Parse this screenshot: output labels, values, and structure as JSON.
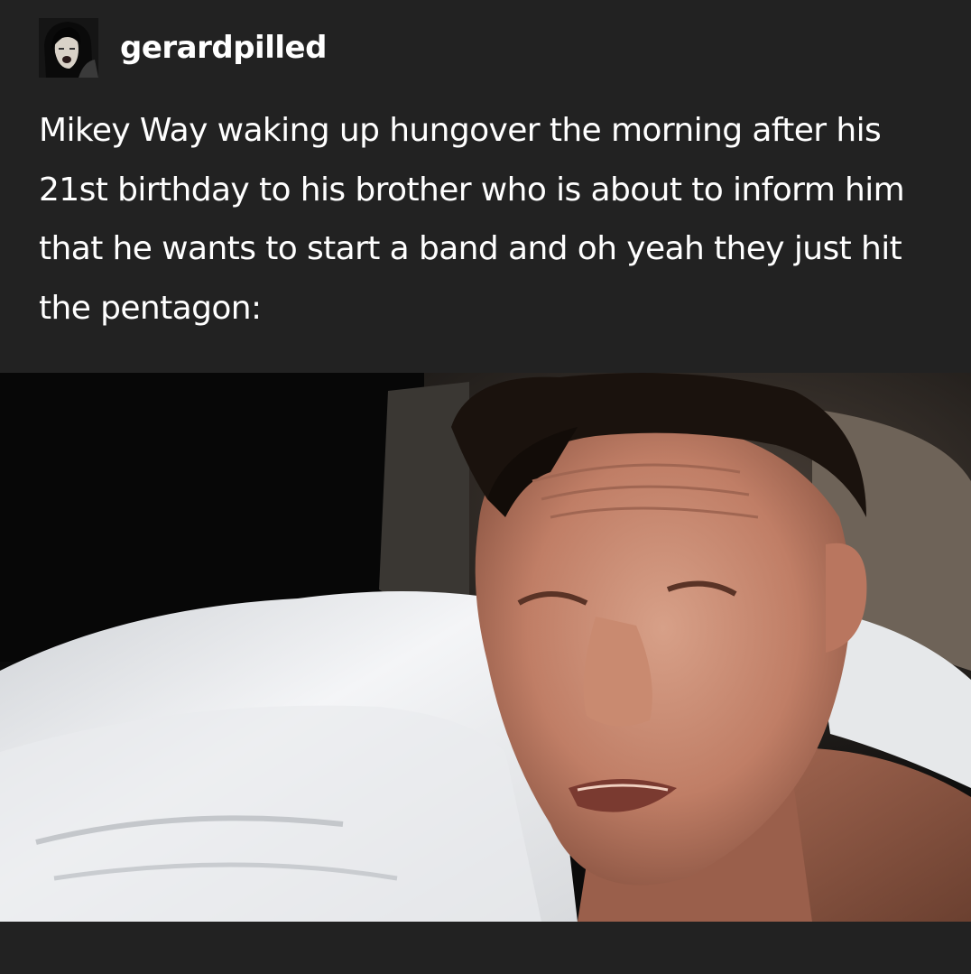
{
  "post": {
    "username": "gerardpilled",
    "avatar_icon": "user-avatar",
    "body_text": "Mikey Way waking up hungover the morning after his 21st birthday to his brother who is about to inform him that he wants to start a band and oh yeah they just hit the pentagon:",
    "image_icon": "photo-man-waking-in-bed"
  },
  "colors": {
    "background": "#222222",
    "text": "#ffffff"
  }
}
